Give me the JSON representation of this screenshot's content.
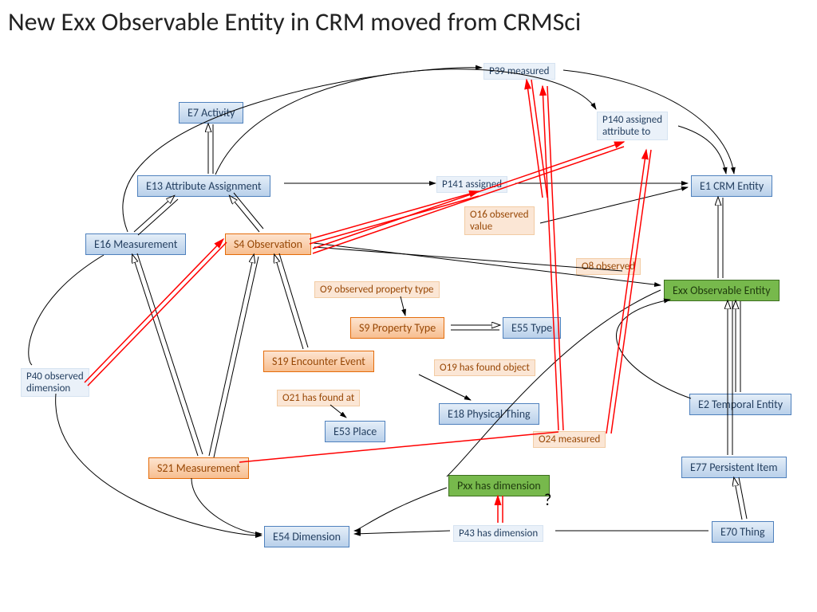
{
  "title": "New Exx Observable Entity in CRM moved from CRMSci",
  "nodes": {
    "e7": "E7 Activity",
    "e13": "E13 Attribute Assignment",
    "e16": "E16 Measurement",
    "s4": "S4 Observation",
    "s9": "S9 Property Type",
    "e55": "E55 Type",
    "s19": "S19 Encounter Event",
    "e53": "E53 Place",
    "e18": "E18 Physical Thing",
    "s21": "S21 Measurement",
    "e54": "E54 Dimension",
    "e1": "E1 CRM Entity",
    "exx": "Exx Observable Entity",
    "e2": "E2 Temporal Entity",
    "e77": "E77 Persistent Item",
    "e70": "E70 Thing",
    "pxx": "Pxx  has dimension"
  },
  "labels": {
    "p39": "P39 measured",
    "p140": "P140 assigned\nattribute to",
    "p141": "P141 assigned",
    "o16": "O16 observed\nvalue",
    "o9": "O9 observed property type",
    "o8": "O8 observed",
    "o19": "O19 has found object",
    "o21": "O21 has found at",
    "o24": "O24 measured",
    "p40": "P40 observed\ndimension",
    "p43": "P43 has dimension",
    "q": "?"
  },
  "chart_data": {
    "type": "diagram",
    "title": "New Exx Observable Entity in CRM moved from CRMSci",
    "entities": [
      {
        "id": "E7",
        "label": "E7 Activity",
        "group": "crm"
      },
      {
        "id": "E13",
        "label": "E13 Attribute Assignment",
        "group": "crm"
      },
      {
        "id": "E16",
        "label": "E16 Measurement",
        "group": "crm"
      },
      {
        "id": "S4",
        "label": "S4 Observation",
        "group": "crmsci"
      },
      {
        "id": "S9",
        "label": "S9 Property Type",
        "group": "crmsci"
      },
      {
        "id": "E55",
        "label": "E55 Type",
        "group": "crm"
      },
      {
        "id": "S19",
        "label": "S19 Encounter Event",
        "group": "crmsci"
      },
      {
        "id": "E53",
        "label": "E53 Place",
        "group": "crm"
      },
      {
        "id": "E18",
        "label": "E18 Physical Thing",
        "group": "crm"
      },
      {
        "id": "S21",
        "label": "S21 Measurement",
        "group": "crmsci"
      },
      {
        "id": "E54",
        "label": "E54 Dimension",
        "group": "crm"
      },
      {
        "id": "E1",
        "label": "E1 CRM Entity",
        "group": "crm"
      },
      {
        "id": "Exx",
        "label": "Exx Observable Entity",
        "group": "new"
      },
      {
        "id": "E2",
        "label": "E2 Temporal Entity",
        "group": "crm"
      },
      {
        "id": "E77",
        "label": "E77 Persistent Item",
        "group": "crm"
      },
      {
        "id": "E70",
        "label": "E70 Thing",
        "group": "crm"
      },
      {
        "id": "Pxx",
        "label": "Pxx has dimension",
        "group": "new"
      }
    ],
    "relations": [
      {
        "from": "E13",
        "to": "E7",
        "kind": "isa"
      },
      {
        "from": "E16",
        "to": "E13",
        "kind": "isa"
      },
      {
        "from": "S4",
        "to": "E13",
        "kind": "isa"
      },
      {
        "from": "S19",
        "to": "S4",
        "kind": "isa"
      },
      {
        "from": "S21",
        "to": "S4",
        "kind": "isa"
      },
      {
        "from": "S21",
        "to": "E16",
        "kind": "isa"
      },
      {
        "from": "S9",
        "to": "E55",
        "kind": "isa"
      },
      {
        "from": "Exx",
        "to": "E1",
        "kind": "isa"
      },
      {
        "from": "E2",
        "to": "Exx",
        "kind": "isa"
      },
      {
        "from": "E77",
        "to": "Exx",
        "kind": "isa"
      },
      {
        "from": "E70",
        "to": "E77",
        "kind": "isa"
      },
      {
        "from": "E13",
        "to": "E1",
        "kind": "prop",
        "label": "P141 assigned"
      },
      {
        "from": "E13",
        "to": "E1",
        "kind": "prop",
        "label": "P140 assigned attribute to"
      },
      {
        "from": "E16",
        "to": "E1",
        "kind": "prop",
        "label": "P39 measured"
      },
      {
        "from": "E16",
        "to": "E54",
        "kind": "prop",
        "label": "P40 observed dimension"
      },
      {
        "from": "S4",
        "to": "E1",
        "kind": "prop",
        "label": "O16 observed value",
        "replaces": "P141"
      },
      {
        "from": "S4",
        "to": "Exx",
        "kind": "prop",
        "label": "O8 observed",
        "replaces": "P140"
      },
      {
        "from": "S4",
        "to": "S9",
        "kind": "prop",
        "label": "O9 observed property type"
      },
      {
        "from": "S19",
        "to": "E18",
        "kind": "prop",
        "label": "O19 has found object"
      },
      {
        "from": "S19",
        "to": "E53",
        "kind": "prop",
        "label": "O21 has found at"
      },
      {
        "from": "S21",
        "to": "E54",
        "kind": "prop",
        "label": "O24 measured",
        "replaces": "P40"
      },
      {
        "from": "E70",
        "to": "E54",
        "kind": "prop",
        "label": "P43 has dimension"
      },
      {
        "from": "Exx",
        "to": "E54",
        "kind": "prop",
        "label": "Pxx has dimension",
        "replaces": "P43",
        "status": "proposed"
      }
    ]
  }
}
